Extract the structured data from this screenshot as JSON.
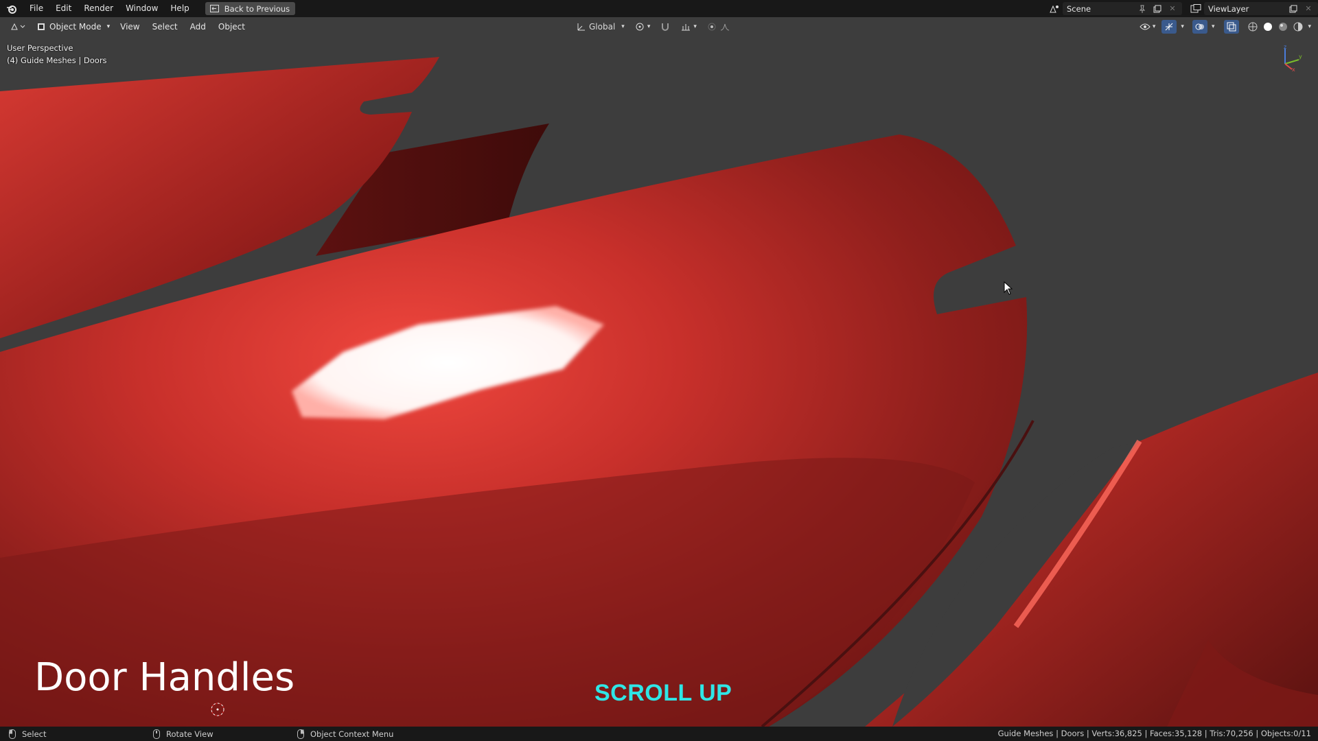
{
  "topbar": {
    "menus": [
      "File",
      "Edit",
      "Render",
      "Window",
      "Help"
    ],
    "back_button": "Back to Previous",
    "scene": "Scene",
    "view_layer": "ViewLayer"
  },
  "header": {
    "mode": "Object Mode",
    "menus": [
      "View",
      "Select",
      "Add",
      "Object"
    ],
    "transform_orientation": "Global"
  },
  "viewport": {
    "perspective": "User Perspective",
    "collection_info": "(4) Guide Meshes | Doors",
    "overlay_title": "Door Handles",
    "overlay_hint": "SCROLL UP",
    "gizmo_axes": [
      "z",
      "y",
      "x"
    ]
  },
  "statusbar": {
    "select": "Select",
    "rotate": "Rotate View",
    "context_menu": "Object Context Menu",
    "stats": "Guide Meshes | Doors | Verts:36,825 | Faces:35,128 | Tris:70,256 | Objects:0/11"
  },
  "colors": {
    "mesh_red": "#c8302b",
    "background": "#3d3d3d",
    "hint_cyan": "#2fe6e6"
  }
}
